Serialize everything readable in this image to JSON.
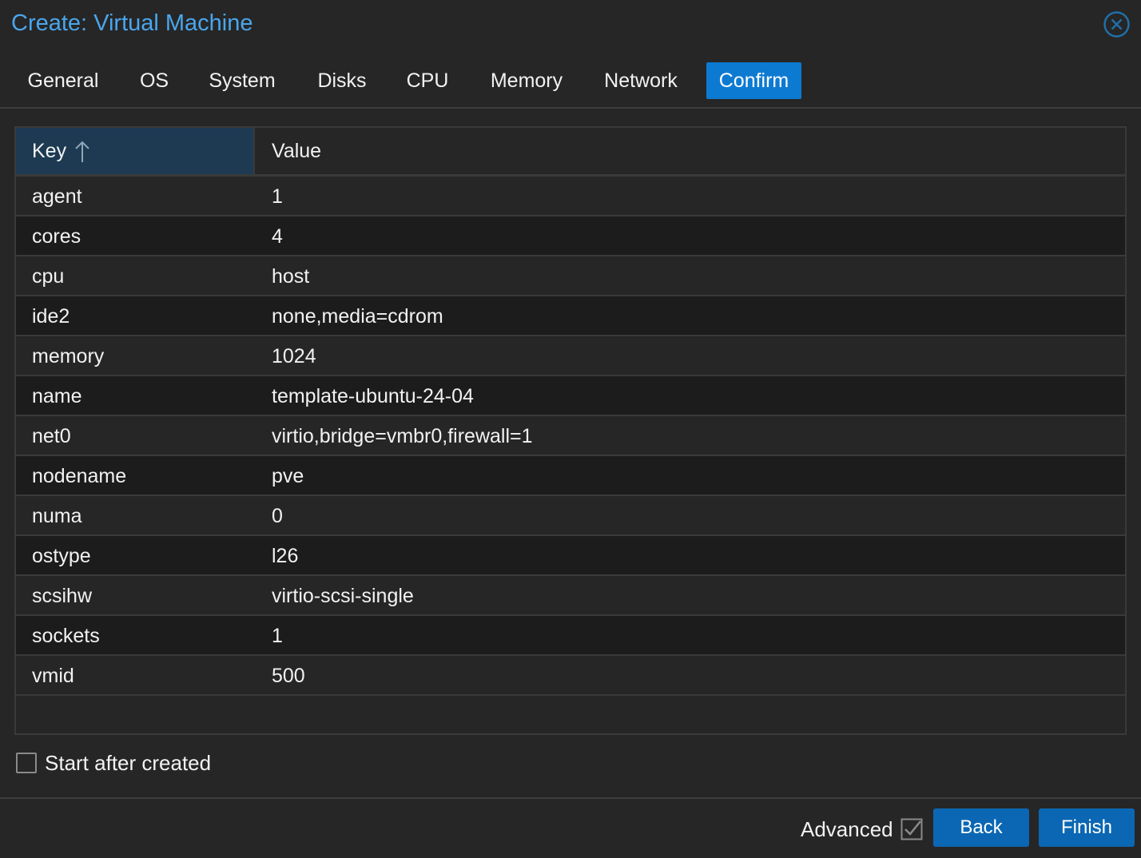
{
  "dialog": {
    "title": "Create: Virtual Machine",
    "close_icon": "close-circle-icon"
  },
  "tabs": [
    {
      "label": "General",
      "active": false
    },
    {
      "label": "OS",
      "active": false
    },
    {
      "label": "System",
      "active": false
    },
    {
      "label": "Disks",
      "active": false
    },
    {
      "label": "CPU",
      "active": false
    },
    {
      "label": "Memory",
      "active": false
    },
    {
      "label": "Network",
      "active": false
    },
    {
      "label": "Confirm",
      "active": true
    }
  ],
  "grid": {
    "columns": {
      "key": "Key",
      "value": "Value"
    },
    "sort_icon": "sort-ascending-icon",
    "rows": [
      {
        "key": "agent",
        "value": "1"
      },
      {
        "key": "cores",
        "value": "4"
      },
      {
        "key": "cpu",
        "value": "host"
      },
      {
        "key": "ide2",
        "value": "none,media=cdrom"
      },
      {
        "key": "memory",
        "value": "1024"
      },
      {
        "key": "name",
        "value": "template-ubuntu-24-04"
      },
      {
        "key": "net0",
        "value": "virtio,bridge=vmbr0,firewall=1"
      },
      {
        "key": "nodename",
        "value": "pve"
      },
      {
        "key": "numa",
        "value": "0"
      },
      {
        "key": "ostype",
        "value": "l26"
      },
      {
        "key": "scsihw",
        "value": "virtio-scsi-single"
      },
      {
        "key": "sockets",
        "value": "1"
      },
      {
        "key": "vmid",
        "value": "500"
      }
    ]
  },
  "options": {
    "start_after_created_label": "Start after created",
    "start_after_created_checked": false
  },
  "footer": {
    "advanced_label": "Advanced",
    "advanced_checked": true,
    "back_label": "Back",
    "finish_label": "Finish"
  },
  "colors": {
    "accent": "#0d7ad2",
    "title": "#4aa6ec",
    "button": "#0b67b3",
    "background": "#262626",
    "selected_header": "#1d3a52"
  }
}
